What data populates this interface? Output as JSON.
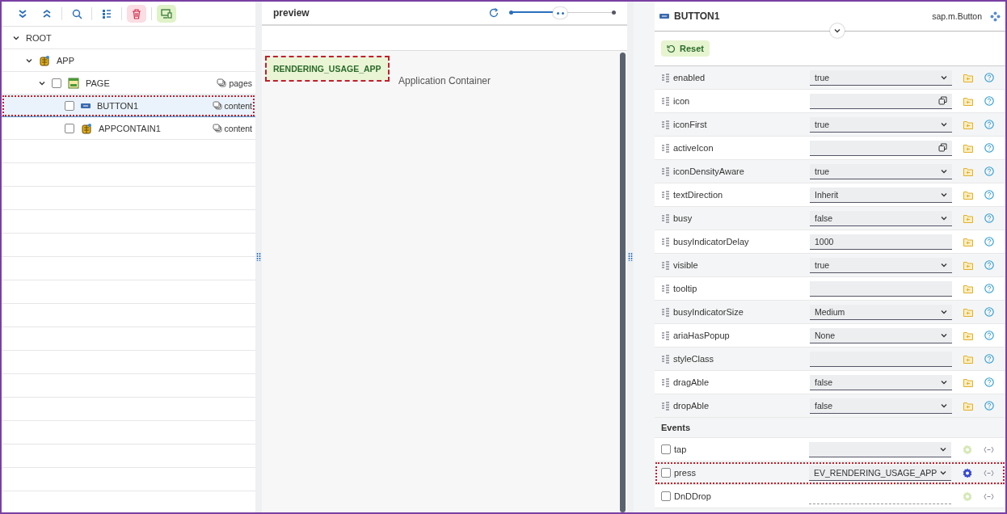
{
  "tree": [
    {
      "label": "ROOT",
      "expanded": true,
      "selected": false,
      "highlighted": false,
      "children": [
        {
          "label": "APP",
          "kind": "app",
          "expanded": true,
          "selected": false,
          "highlighted": false,
          "children": [
            {
              "label": "PAGE",
              "kind": "page",
              "checked": false,
              "aggregation": "pages",
              "expanded": true,
              "selected": false,
              "highlighted": false,
              "children": [
                {
                  "label": "BUTTON1",
                  "kind": "button",
                  "checked": false,
                  "aggregation": "content",
                  "selected": true,
                  "highlighted": true
                },
                {
                  "label": "APPCONTAIN1",
                  "kind": "app",
                  "checked": false,
                  "aggregation": "content",
                  "selected": false,
                  "highlighted": false
                }
              ]
            }
          ]
        }
      ]
    }
  ],
  "preview": {
    "title": "preview",
    "zoom": {
      "level": 0.48
    },
    "button": {
      "label": "RENDERING_USAGE_APP",
      "highlighted": true
    },
    "container_label": "Application Container"
  },
  "properties": {
    "title": "BUTTON1",
    "type": "sap.m.Button",
    "reset": "Reset",
    "items": [
      {
        "name": "enabled",
        "kind": "select",
        "value": "true"
      },
      {
        "name": "icon",
        "kind": "valuehelp"
      },
      {
        "name": "iconFirst",
        "kind": "select",
        "value": "true"
      },
      {
        "name": "activeIcon",
        "kind": "valuehelp"
      },
      {
        "name": "iconDensityAware",
        "kind": "select",
        "value": "true"
      },
      {
        "name": "textDirection",
        "kind": "select",
        "value": "Inherit"
      },
      {
        "name": "busy",
        "kind": "select",
        "value": "false"
      },
      {
        "name": "busyIndicatorDelay",
        "kind": "input",
        "value": "1000"
      },
      {
        "name": "visible",
        "kind": "select",
        "value": "true"
      },
      {
        "name": "tooltip",
        "kind": "input"
      },
      {
        "name": "busyIndicatorSize",
        "kind": "select",
        "value": "Medium"
      },
      {
        "name": "ariaHasPopup",
        "kind": "select",
        "value": "None"
      },
      {
        "name": "styleClass",
        "kind": "input"
      },
      {
        "name": "dragAble",
        "kind": "select",
        "value": "false"
      },
      {
        "name": "dropAble",
        "kind": "select",
        "value": "false"
      }
    ],
    "events_heading": "Events",
    "events": [
      {
        "name": "tap",
        "kind": "select",
        "checked": false,
        "assigned": false,
        "highlighted": false
      },
      {
        "name": "press",
        "kind": "select",
        "value": "EV_RENDERING_USAGE_APP",
        "checked": false,
        "assigned": true,
        "highlighted": true
      },
      {
        "name": "DnDDrop",
        "kind": "none",
        "checked": false,
        "assigned": false,
        "highlighted": false
      }
    ]
  }
}
